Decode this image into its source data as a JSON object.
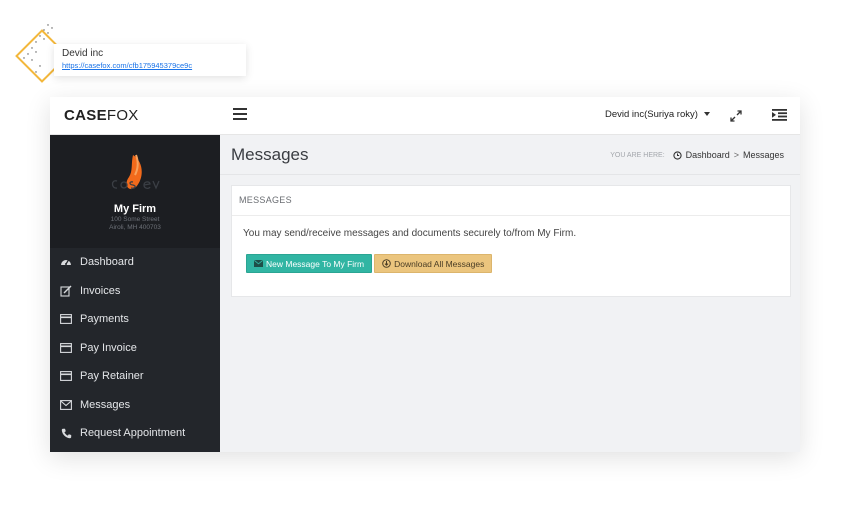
{
  "callout": {
    "title": "Devid inc",
    "link": "https://casefox.com/cfb175945379ce9c"
  },
  "topbar": {
    "brand_bold": "CASE",
    "brand_light": "FOX",
    "user": "Devid inc(Suriya roky)"
  },
  "sidebar": {
    "firm_name": "My Firm",
    "address_line1": "100 Some Street",
    "address_line2": "Airoli, MH 400703",
    "items": [
      {
        "label": "Dashboard",
        "icon": "dashboard-gauge-icon"
      },
      {
        "label": "Invoices",
        "icon": "edit-icon"
      },
      {
        "label": "Payments",
        "icon": "credit-card-icon"
      },
      {
        "label": "Pay Invoice",
        "icon": "credit-card-icon"
      },
      {
        "label": "Pay Retainer",
        "icon": "credit-card-icon"
      },
      {
        "label": "Messages",
        "icon": "envelope-icon"
      },
      {
        "label": "Request Appointment",
        "icon": "phone-icon"
      }
    ]
  },
  "page": {
    "title": "Messages",
    "breadcrumb": {
      "here": "YOU ARE HERE:",
      "home": "Dashboard",
      "separator": ">",
      "current": "Messages"
    }
  },
  "panel": {
    "heading": "MESSAGES",
    "text": "You may send/receive messages and documents securely to/from My Firm.",
    "new_message_button": "New Message To My Firm",
    "download_button": "Download All Messages"
  },
  "colors": {
    "sidebar_bg": "#23262b",
    "accent_green": "#31b5a3",
    "accent_yellow": "#ebc57e",
    "callout_accent": "#f3b73b",
    "logo_orange": "#f26a1b"
  }
}
